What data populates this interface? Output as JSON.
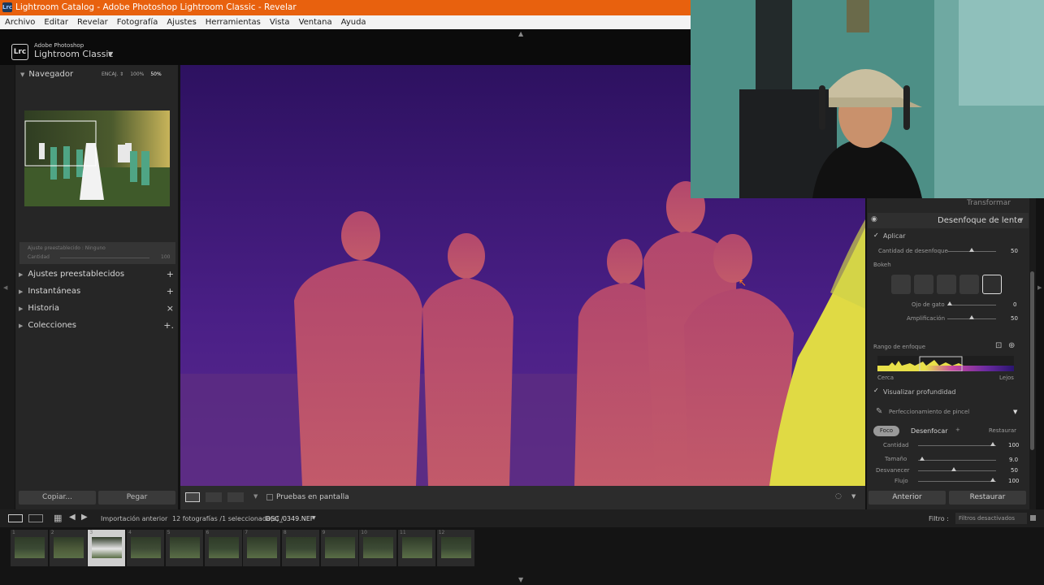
{
  "window": {
    "title": "Lightroom Catalog - Adobe Photoshop Lightroom Classic - Revelar",
    "app_icon": "Lrc"
  },
  "menu": [
    "Archivo",
    "Editar",
    "Revelar",
    "Fotografía",
    "Ajustes",
    "Herramientas",
    "Vista",
    "Ventana",
    "Ayuda"
  ],
  "identity": {
    "badge": "Lrc",
    "line1": "Adobe Photoshop",
    "line2": "Lightroom Classic"
  },
  "left_panel": {
    "navigator_title": "Navegador",
    "zoom_options": [
      "ENCAJ. ⇕",
      "100%",
      "50%"
    ],
    "preset_strip": {
      "label": "Ajuste preestablecido : Ninguno",
      "amount_label": "Cantidad",
      "amount_value": "100"
    },
    "sections": [
      {
        "label": "Ajustes preestablecidos",
        "action": "+"
      },
      {
        "label": "Instantáneas",
        "action": "+"
      },
      {
        "label": "Historia",
        "action": "×"
      },
      {
        "label": "Colecciones",
        "action": "+."
      }
    ],
    "copy_button": "Copiar...",
    "paste_button": "Pegar"
  },
  "toolbar": {
    "soft_proof_label": "Pruebas en pantalla"
  },
  "right_panel": {
    "prev_section": "Transformar",
    "section_title": "Desenfoque de lente",
    "apply_label": "Aplicar",
    "blur_amount_label": "Cantidad de desenfoque",
    "blur_amount_value": "50",
    "bokeh_label": "Bokeh",
    "cat_eye_label": "Ojo de gato",
    "cat_eye_value": "0",
    "boost_label": "Amplificación",
    "boost_value": "50",
    "focus_range_label": "Rango de enfoque",
    "near_label": "Cerca",
    "far_label": "Lejos",
    "visualize_depth_label": "Visualizar profundidad",
    "brush_refine_label": "Perfeccionamiento de pincel",
    "focus_btn": "Foco",
    "defocus_btn": "Desenfocar",
    "reset_link": "Restaurar",
    "brush": [
      {
        "label": "Cantidad",
        "value": "100"
      },
      {
        "label": "Tamaño",
        "value": "9.0"
      },
      {
        "label": "Desvanecer",
        "value": "50"
      },
      {
        "label": "Flujo",
        "value": "100"
      }
    ],
    "previous_button": "Anterior",
    "reset_button": "Restaurar"
  },
  "filmstrip": {
    "source_label": "Importación anterior",
    "count_label": "12 fotografías /1 seleccionada(s) /",
    "filename": "DSC_0349.NEF",
    "filter_label": "Filtro :",
    "filter_value": "Filtros desactivados",
    "thumbs": [
      "1",
      "2",
      "3",
      "4",
      "5",
      "6",
      "7",
      "8",
      "9",
      "10",
      "11",
      "12"
    ],
    "selected_index": 3
  },
  "colors": {
    "titlebar": "#e8610e",
    "panel_bg": "#262626",
    "depth_near": "#e8e049",
    "depth_far": "#3a1a7a"
  }
}
